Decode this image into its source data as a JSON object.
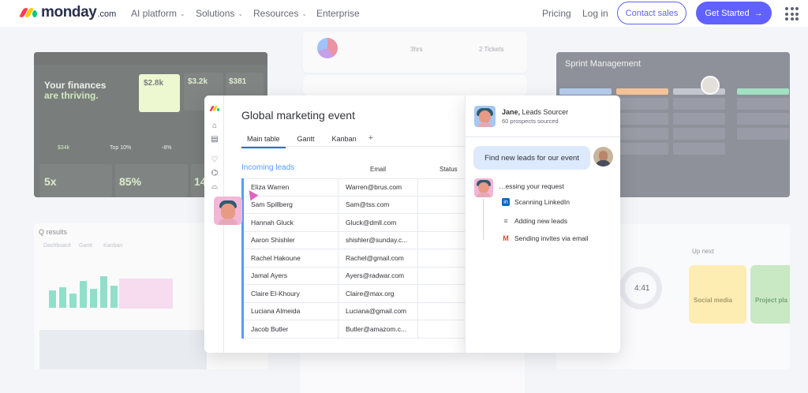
{
  "nav": {
    "logo_word": "monday",
    "logo_suffix": ".com",
    "items": [
      {
        "label": "AI platform"
      },
      {
        "label": "Solutions"
      },
      {
        "label": "Resources"
      },
      {
        "label": "Enterprise"
      }
    ],
    "pricing": "Pricing",
    "login": "Log in",
    "contact_sales": "Contact sales",
    "get_started": "Get Started",
    "get_started_arrow": "→",
    "brand_colors": [
      "#ff3d57",
      "#ffcb00",
      "#00ca72"
    ],
    "accent": "#6161ff"
  },
  "background": {
    "finance": {
      "title_1": "Your finances",
      "title_2": "are thriving.",
      "value_1": "$2.8k",
      "value_2": "$3.2k",
      "value_3": "$381",
      "stat_1": "5x",
      "stat_2": "85%",
      "stat_3": "14",
      "badge": "Top 10%",
      "pct": "-8%",
      "small": "$34k"
    },
    "top_stats": [
      "3hrs",
      "2 Tickets"
    ],
    "sprint": {
      "title": "Sprint Management"
    },
    "qresults": {
      "title": "Q results",
      "tabs": [
        "Dashboard",
        "Gantt",
        "Kanban"
      ]
    },
    "up_next": "Up next",
    "timer": "4:41",
    "social": "Social media",
    "project": "Project pla"
  },
  "board": {
    "title": "Global marketing event",
    "tabs": [
      {
        "label": "Main table"
      },
      {
        "label": "Gantt"
      },
      {
        "label": "Kanban"
      }
    ],
    "add_tab": "+",
    "group_title": "Incoming leads",
    "columns": {
      "email": "Email",
      "status": "Status"
    },
    "rows": [
      {
        "name": "Eliza Warren",
        "email": "Warren@brus.com"
      },
      {
        "name": "Sam Spillberg",
        "email": "Sam@tss.com"
      },
      {
        "name": "Hannah Gluck",
        "email": "Gluck@dmll.com"
      },
      {
        "name": "Aaron Shishler",
        "email": "shishler@sunday.c..."
      },
      {
        "name": "Rachel Hakoune",
        "email": "Rachel@gmail.com"
      },
      {
        "name": "Jamal Ayers",
        "email": "Ayers@radwar.com"
      },
      {
        "name": "Claire El-Khoury",
        "email": "Claire@max.org"
      },
      {
        "name": "Luciana Almeida",
        "email": "Luciana@gmail.com"
      },
      {
        "name": "Jacob Butler",
        "email": "Butler@amazom.c..."
      }
    ]
  },
  "agent": {
    "name": "Jane,",
    "role": "Leads Sourcer",
    "subtitle": "60 prospects sourced",
    "bubble": "Find new leads for our event",
    "processing": "…essing your request",
    "steps": [
      {
        "label": "Scanning LinkedIn",
        "icon": "linkedin-icon"
      },
      {
        "label": "Adding new leads",
        "icon": "list-add-icon"
      },
      {
        "label": "Sending invites via email",
        "icon": "gmail-icon"
      }
    ]
  }
}
